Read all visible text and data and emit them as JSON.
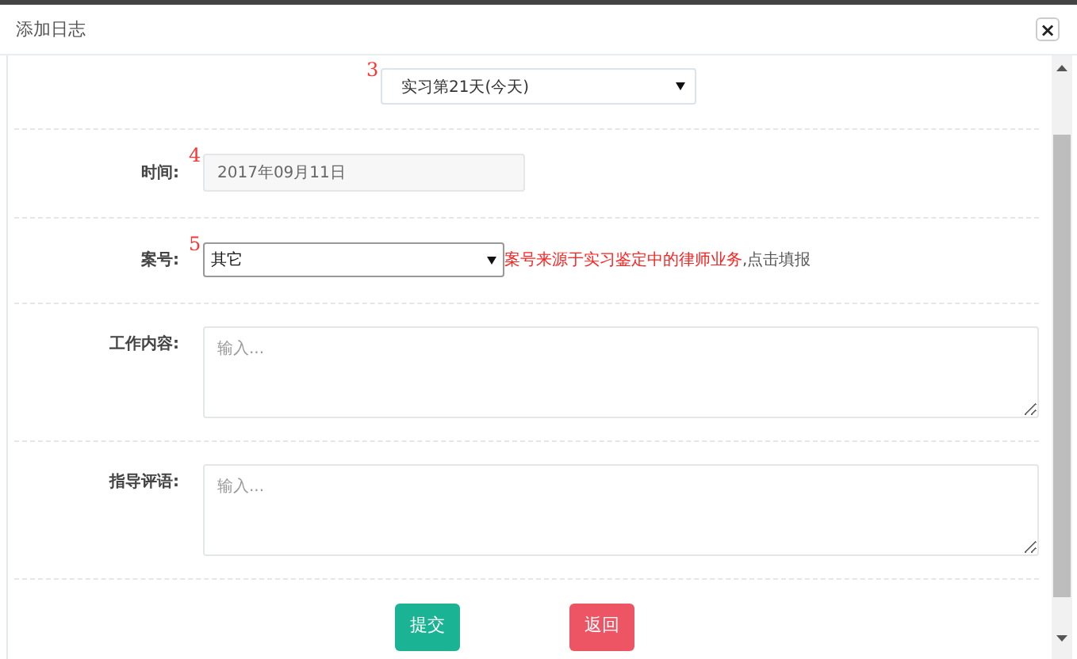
{
  "dialog": {
    "title": "添加日志",
    "close_label": "×"
  },
  "day_select": {
    "marker": "3",
    "value": "实习第21天(今天)"
  },
  "fields": [
    {
      "kind": "readonly",
      "label": "时间:",
      "marker": "4",
      "value": "2017年09月11日"
    },
    {
      "kind": "select",
      "label": "案号:",
      "marker": "5",
      "value": "其它",
      "note_red": "案号来源于实习鉴定中的律师业务",
      "note": ",点击填报"
    },
    {
      "kind": "textarea",
      "label": "工作内容:",
      "placeholder": "输入..."
    },
    {
      "kind": "textarea",
      "label": "指导评语:",
      "placeholder": "输入..."
    }
  ],
  "buttons": [
    {
      "kind": "primary",
      "label": "提交"
    },
    {
      "kind": "danger",
      "label": "返回"
    }
  ]
}
